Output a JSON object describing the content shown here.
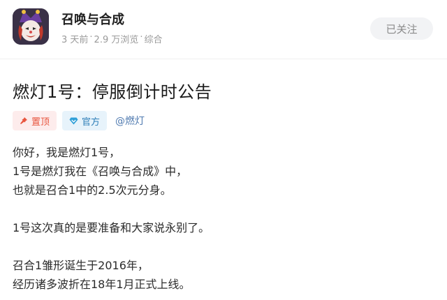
{
  "header": {
    "author_name": "召唤与合成",
    "meta_time": "3 天前",
    "meta_dot1": "·",
    "meta_views": "2.9 万浏览",
    "meta_dot2": "·",
    "meta_category": "综合",
    "follow_label": "已关注"
  },
  "post": {
    "title": "燃灯1号：停服倒计时公告",
    "tags": {
      "pin_label": "置顶",
      "official_label": "官方",
      "mention_label": "@燃灯"
    },
    "paragraphs": {
      "p1": [
        "你好，我是燃灯1号，",
        "1号是燃灯我在《召唤与合成》中，",
        "也就是召合1中的2.5次元分身。"
      ],
      "p2": [
        "1号这次真的是要准备和大家说永别了。"
      ],
      "p3": [
        "召合1雏形诞生于2016年，",
        "经历诸多波折在18年1月正式上线。"
      ]
    }
  },
  "colors": {
    "pin_tag_bg": "#fdecec",
    "pin_tag_text": "#e8553e",
    "official_tag_bg": "#e7f3fb",
    "official_tag_text": "#2e7fb8",
    "mention_text": "#4f7ab0"
  },
  "icons": {
    "pin": "pin-icon",
    "official": "diamond-check-icon",
    "avatar": "clown-character-avatar"
  }
}
